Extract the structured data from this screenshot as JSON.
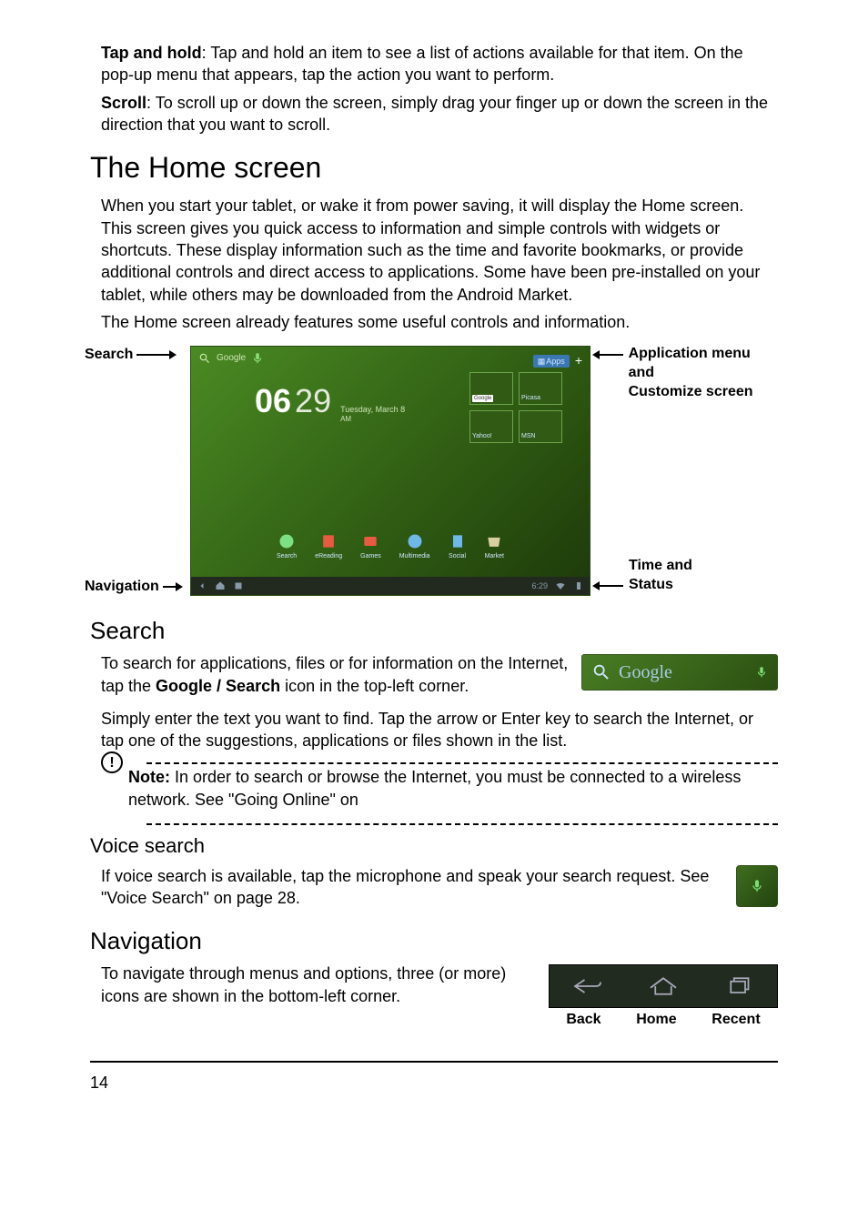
{
  "tap_hold_bold": "Tap and hold",
  "tap_hold_rest": ": Tap and hold an item to see a list of actions available for that item. On the pop-up menu that appears, tap the action you want to perform.",
  "scroll_bold": "Scroll",
  "scroll_rest": ": To scroll up or down the screen, simply drag your finger up or down the screen in the direction that you want to scroll.",
  "h1_home": "The Home screen",
  "home_p1": "When you start your tablet, or wake it from power saving, it will display the Home screen. This screen gives you quick access to information and simple controls with widgets or shortcuts. These display information such as the time and favorite bookmarks, or provide additional controls and direct access to applications. Some have been pre-installed on your tablet, while others may be downloaded from the Android Market.",
  "home_p2": "The Home screen already features some useful controls and information.",
  "callouts": {
    "search": "Search",
    "navigation": "Navigation",
    "appmenu": "Application menu and",
    "customize": "Customize screen",
    "timestatus": "Time and Status"
  },
  "screenshot": {
    "search_label": "Google",
    "clock_hh": "06",
    "clock_mm": "29",
    "clock_am": "AM",
    "clock_date": "Tuesday, March 8",
    "apps_label": "Apps",
    "widgets": [
      "Google",
      "Picasa",
      "Yahoo!",
      "MSN"
    ],
    "dock": [
      "Search",
      "eReading",
      "Games",
      "Multimedia",
      "Social",
      "Market"
    ],
    "nav_time": "6:29"
  },
  "h2_search": "Search",
  "search_p1a": "To search for applications, files or for information on the Internet, tap the ",
  "search_p1_bold": "Google / Search",
  "search_p1b": " icon in the top-left corner.",
  "google_brand": "Google",
  "search_p2": "Simply enter the text you want to find. Tap the arrow or Enter key to search the Internet, or tap one of the suggestions, applications or files shown in the list.",
  "note_bold": "Note:",
  "note_rest": " In order to search or browse the Internet, you must be connected to a wireless network. See \"Going Online\" on",
  "h3_voice": "Voice search",
  "voice_p1": "If voice search is available, tap the microphone and speak your search request. See \"Voice Search\" on page 28.",
  "h2_nav": "Navigation",
  "nav_p1": "To navigate through menus and options, three (or more) icons are shown in the bottom-left corner.",
  "navlabels": {
    "back": "Back",
    "home": "Home",
    "recent": "Recent"
  },
  "page_number": "14"
}
